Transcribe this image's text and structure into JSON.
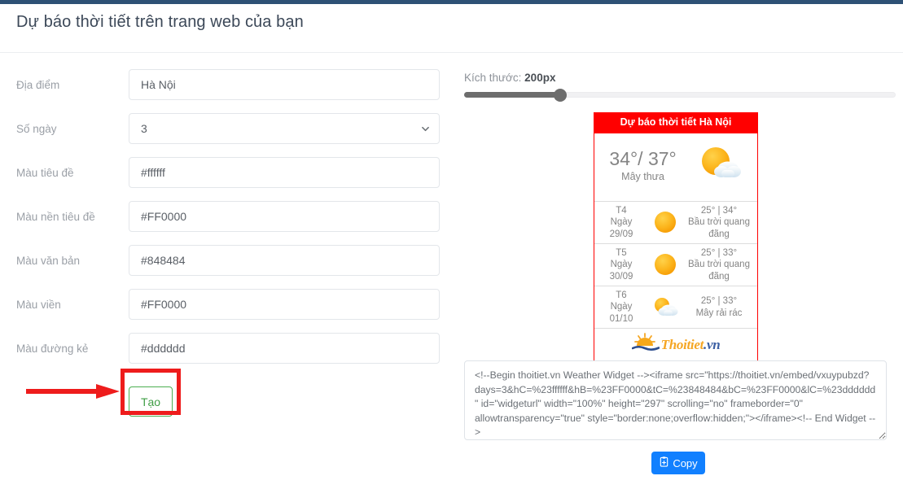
{
  "page": {
    "title": "Dự báo thời tiết trên trang web của bạn",
    "topbar_color": "#2e5175"
  },
  "form": {
    "fields": [
      {
        "label": "Địa điểm",
        "name": "location",
        "type": "text",
        "value": "Hà Nội",
        "placeholder": ""
      },
      {
        "label": "Số ngày",
        "name": "days",
        "type": "select",
        "value": "3",
        "options": [
          "3"
        ]
      },
      {
        "label": "Màu tiêu đề",
        "name": "header-color",
        "type": "text",
        "value": "#ffffff",
        "placeholder": ""
      },
      {
        "label": "Màu nền tiêu đề",
        "name": "header-bg-color",
        "type": "text",
        "value": "#FF0000",
        "placeholder": ""
      },
      {
        "label": "Màu văn bản",
        "name": "text-color",
        "type": "text",
        "value": "#848484",
        "placeholder": ""
      },
      {
        "label": "Màu viền",
        "name": "border-color",
        "type": "text",
        "value": "#FF0000",
        "placeholder": ""
      },
      {
        "label": "Màu đường kẻ",
        "name": "line-color",
        "type": "text",
        "value": "#dddddd",
        "placeholder": ""
      }
    ],
    "create_button": "Tạo"
  },
  "annotation": {
    "highlight_color": "#ee1c1c",
    "target": "Tạo"
  },
  "preview": {
    "size_label_prefix": "Kích thước: ",
    "size_value": "200px",
    "slider": {
      "min": 100,
      "max": 1000,
      "value": 200,
      "percent": 22
    }
  },
  "widget": {
    "header": "Dự báo thời tiết Hà Nội",
    "current": {
      "temps": "34°/ 37°",
      "description": "Mây thưa",
      "icon": "sun-behind-cloud-icon"
    },
    "days": [
      {
        "weekday": "T4",
        "date_prefix": "Ngày",
        "date": "29/09",
        "icon": "sun-icon",
        "temps": "25°  |  34°",
        "description": "Bầu trời quang đãng"
      },
      {
        "weekday": "T5",
        "date_prefix": "Ngày",
        "date": "30/09",
        "icon": "sun-icon",
        "temps": "25°  |  33°",
        "description": "Bầu trời quang đãng"
      },
      {
        "weekday": "T6",
        "date_prefix": "Ngày",
        "date": "01/10",
        "icon": "sun-behind-cloud-icon",
        "temps": "25°  |  33°",
        "description": "Mây rải rác"
      }
    ],
    "brand": {
      "name": "Thoitiet",
      "tld": ".vn",
      "icon": "sunrise-over-water-icon"
    },
    "colors": {
      "header_bg": "#FF0000",
      "header_text": "#ffffff",
      "text": "#848484",
      "border": "#FF0000",
      "line": "#dddddd"
    }
  },
  "embed": {
    "code": "<!--Begin thoitiet.vn Weather Widget --><iframe src=\"https://thoitiet.vn/embed/vxuypubzd?days=3&hC=%23ffffff&hB=%23FF0000&tC=%23848484&bC=%23FF0000&lC=%23dddddd\" id=\"widgeturl\" width=\"100%\" height=\"297\" scrolling=\"no\" frameborder=\"0\" allowtransparency=\"true\" style=\"border:none;overflow:hidden;\"></iframe><!-- End Widget -->",
    "copy_button": "Copy"
  }
}
